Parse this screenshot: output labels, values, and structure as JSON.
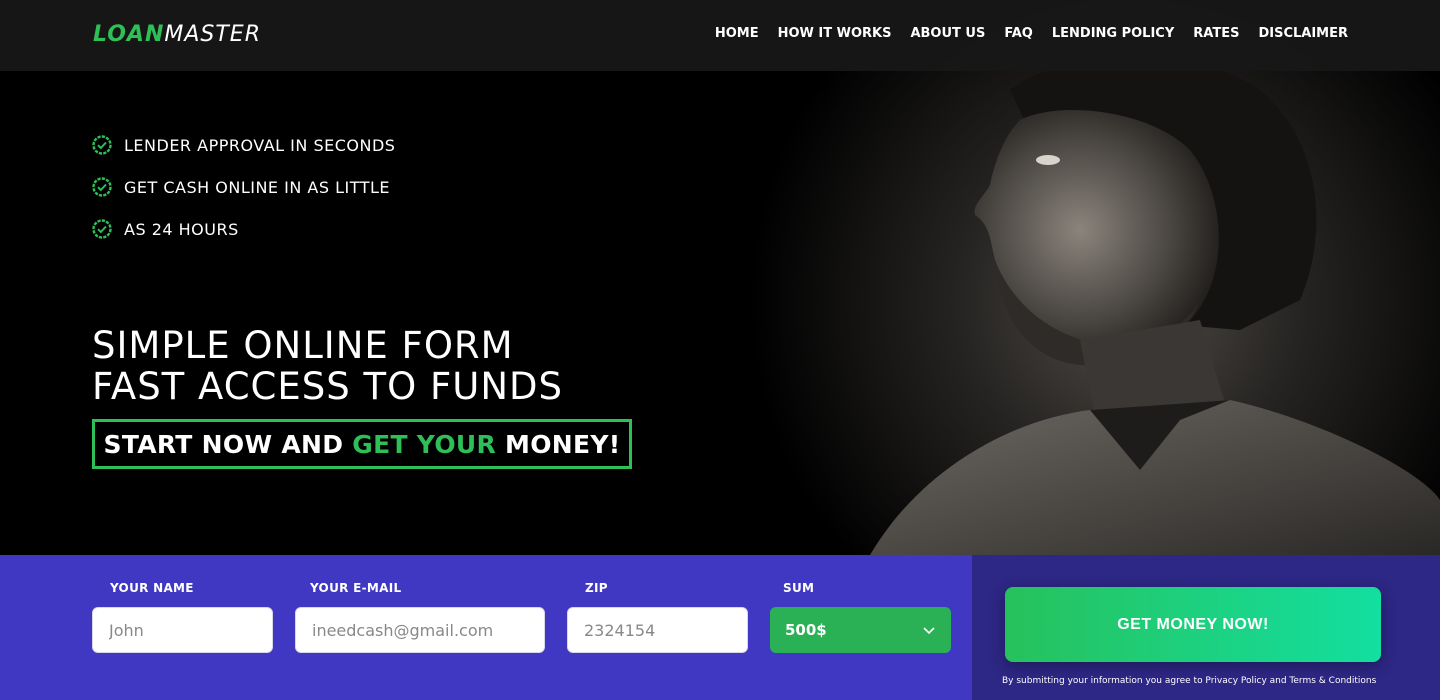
{
  "header": {
    "logo_part1": "LOAN",
    "logo_part2": "MASTER",
    "nav": [
      "HOME",
      "HOW IT WORKS",
      "ABOUT US",
      "FAQ",
      "LENDING POLICY",
      "RATES",
      "DISCLAIMER"
    ]
  },
  "features": [
    "LENDER APPROVAL IN SECONDS",
    "GET CASH ONLINE IN AS LITTLE",
    "AS 24 HOURS"
  ],
  "headline": {
    "line1": "SIMPLE ONLINE FORM",
    "line2": "FAST ACCESS TO FUNDS"
  },
  "cta": {
    "part1": "START NOW AND ",
    "part2": "GET YOUR",
    "part3": " MONEY!"
  },
  "form": {
    "name_label": "YOUR NAME",
    "name_placeholder": "John",
    "email_label": "YOUR E-MAIL",
    "email_placeholder": "ineedcash@gmail.com",
    "zip_label": "ZIP",
    "zip_placeholder": "2324154",
    "sum_label": "SUM",
    "sum_value": "500$"
  },
  "submit": {
    "button_label": "GET MONEY NOW!",
    "disclaimer": "By submitting your information you agree to Privacy Policy and Terms & Conditions"
  },
  "colors": {
    "accent_green": "#2fbf57",
    "form_bar": "#4038c3",
    "submit_panel": "#2d2785"
  },
  "icons": {
    "feature_icon": "check-badge-icon",
    "select_icon": "chevron-down-icon",
    "hero_image": "man-portrait-photo"
  }
}
